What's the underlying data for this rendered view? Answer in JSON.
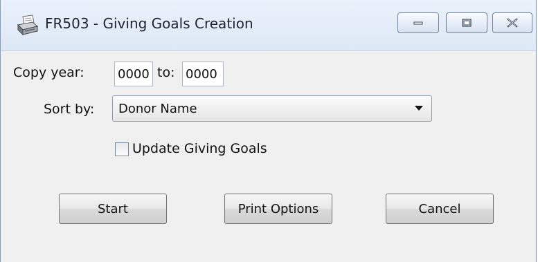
{
  "window": {
    "title": "FR503 - Giving Goals Creation",
    "icon": "printer-icon"
  },
  "form": {
    "copy_year_label": "Copy year:",
    "from_year_value": "0000",
    "to_label": "to:",
    "to_year_value": "0000",
    "sort_by_label": "Sort by:",
    "sort_by_value": "Donor Name",
    "update_goals_label": "Update Giving Goals",
    "update_goals_checked": false
  },
  "buttons": {
    "start_label": "Start",
    "print_options_label": "Print Options",
    "cancel_label": "Cancel"
  }
}
